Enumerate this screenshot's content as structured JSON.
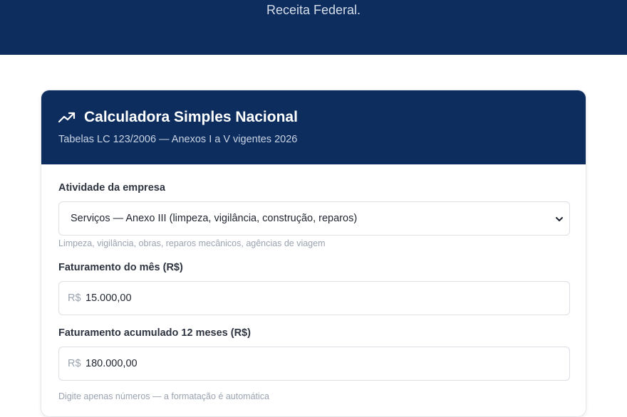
{
  "hero": {
    "text": "Receita Federal."
  },
  "card": {
    "title": "Calculadora Simples Nacional",
    "subtitle": "Tabelas LC 123/2006 — Anexos I a V vigentes 2026",
    "icon": "trending-up-icon"
  },
  "form": {
    "activity": {
      "label": "Atividade da empresa",
      "selected": "Serviços — Anexo III (limpeza, vigilância, construção, reparos)",
      "hint": "Limpeza, vigilância, obras, reparos mecânicos, agências de viagem"
    },
    "monthly": {
      "label": "Faturamento do mês (R$)",
      "prefix": "R$",
      "value": "15.000,00"
    },
    "annual": {
      "label": "Faturamento acumulado 12 meses (R$)",
      "prefix": "R$",
      "value": "180.000,00",
      "hint": "Digite apenas números — a formatação é automática"
    }
  },
  "colors": {
    "brand_navy": "#0d2d5e"
  }
}
